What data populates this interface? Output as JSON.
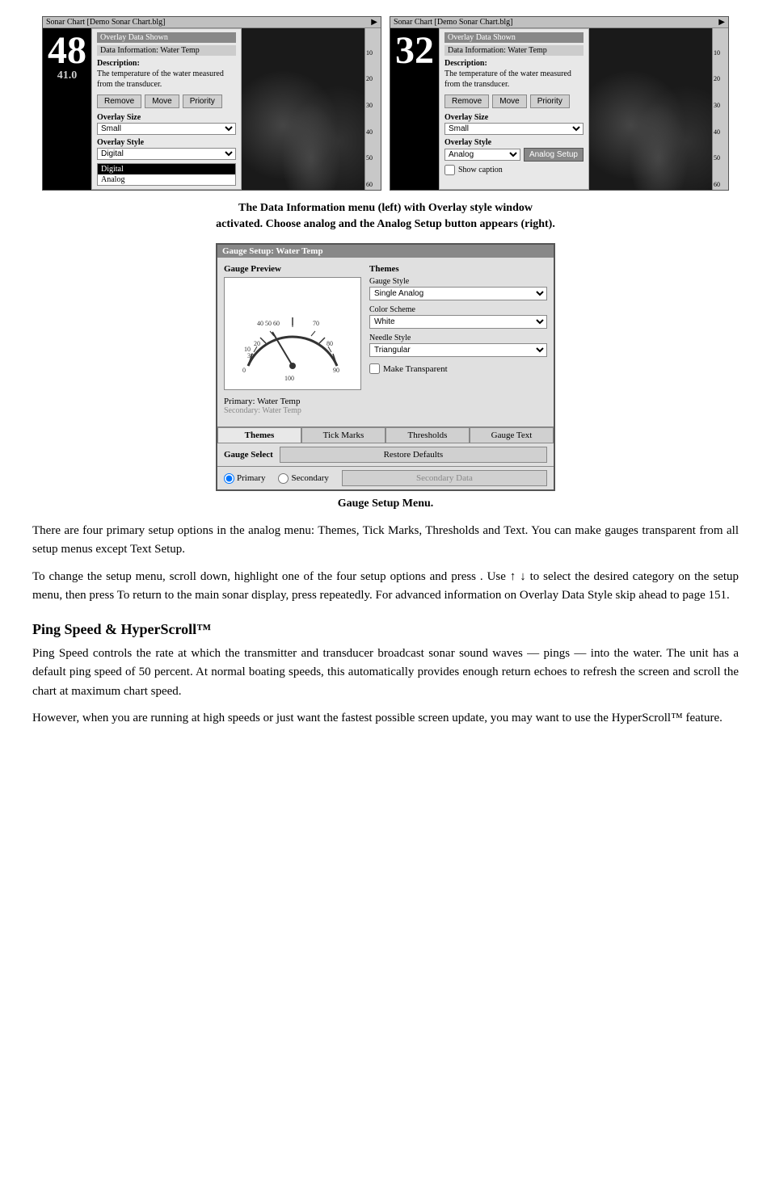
{
  "sonar_panels": {
    "left": {
      "title": "Sonar Chart  [Demo Sonar Chart.blg]",
      "arrow": "▶",
      "big_number": "48",
      "sub_number": "41.0",
      "overlay_shown": "Overlay Data Shown",
      "data_info": "Data Information: Water Temp",
      "description_label": "Description:",
      "description_text": "The temperature of the water measured from the transducer.",
      "remove_btn": "Remove",
      "move_btn": "Move",
      "priority_btn": "Priority",
      "overlay_size_label": "Overlay Size",
      "overlay_size_value": "Small",
      "overlay_style_label": "Overlay Style",
      "overlay_style_value": "Digital",
      "dropdown_options": [
        "Digital",
        "Analog"
      ]
    },
    "right": {
      "title": "Sonar Chart  [Demo Sonar Chart.blg]",
      "arrow": "▶",
      "big_number": "32",
      "sub_number": "",
      "overlay_shown": "Overlay Data Shown",
      "data_info": "Data Information: Water Temp",
      "description_label": "Description:",
      "description_text": "The temperature of the water measured from the transducer.",
      "remove_btn": "Remove",
      "move_btn": "Move",
      "priority_btn": "Priority",
      "overlay_size_label": "Overlay Size",
      "overlay_size_value": "Small",
      "overlay_style_label": "Overlay Style",
      "overlay_style_value": "Analog",
      "analog_setup_btn": "Analog Setup",
      "show_caption_label": "Show caption"
    }
  },
  "top_caption": {
    "line1": "The Data Information menu (left) with Overlay style window",
    "line2": "activated. Choose analog and the Analog Setup button appears (right)."
  },
  "gauge_setup": {
    "title": "Gauge Setup: Water Temp",
    "preview_label": "Gauge Preview",
    "themes_label": "Themes",
    "gauge_style_label": "Gauge Style",
    "gauge_style_value": "Single Analog",
    "color_scheme_label": "Color Scheme",
    "color_scheme_value": "White",
    "needle_style_label": "Needle Style",
    "needle_style_value": "Triangular",
    "make_transparent_label": "Make Transparent",
    "primary_label": "Primary:",
    "primary_value": "Water Temp",
    "secondary_label": "Secondary:",
    "secondary_value": "Water Temp",
    "tabs": [
      "Themes",
      "Tick Marks",
      "Thresholds",
      "Gauge Text"
    ],
    "active_tab": "Themes",
    "gauge_select_label": "Gauge Select",
    "primary_radio": "Primary",
    "secondary_radio": "Secondary",
    "restore_btn": "Restore Defaults",
    "secondary_data_btn": "Secondary Data",
    "gauge_numbers": [
      "0",
      "10",
      "20",
      "30",
      "40",
      "50",
      "60",
      "70",
      "80",
      "90",
      "100"
    ]
  },
  "gauge_caption": "Gauge Setup Menu.",
  "body_paragraphs": [
    "There are four primary setup options in the analog menu: Themes, Tick Marks, Thresholds and Text. You can make gauges transparent from all setup menus except Text Setup.",
    "To change the setup menu, scroll down, highlight one of the four setup options and press      . Use ↑ ↓ to select the desired category on the setup menu, then press      To return to the main sonar display, press       repeatedly. For advanced information on Overlay Data Style skip ahead to page 151."
  ],
  "section_heading": "Ping Speed & HyperScroll™",
  "section_paragraphs": [
    "Ping Speed controls the rate at which the transmitter and transducer broadcast sonar sound waves — pings — into the water. The unit has a default ping speed of 50 percent. At normal boating speeds, this automatically provides enough return echoes to refresh the screen and scroll the chart at maximum chart speed.",
    "However, when you are running at high speeds or just want the fastest possible screen update, you may want to use the HyperScroll™ feature."
  ],
  "depth_scales": {
    "left": [
      "",
      "10",
      "20",
      "30",
      "40",
      "50",
      "60"
    ],
    "right": [
      "",
      "10",
      "20",
      "30",
      "40",
      "50",
      "60"
    ]
  }
}
